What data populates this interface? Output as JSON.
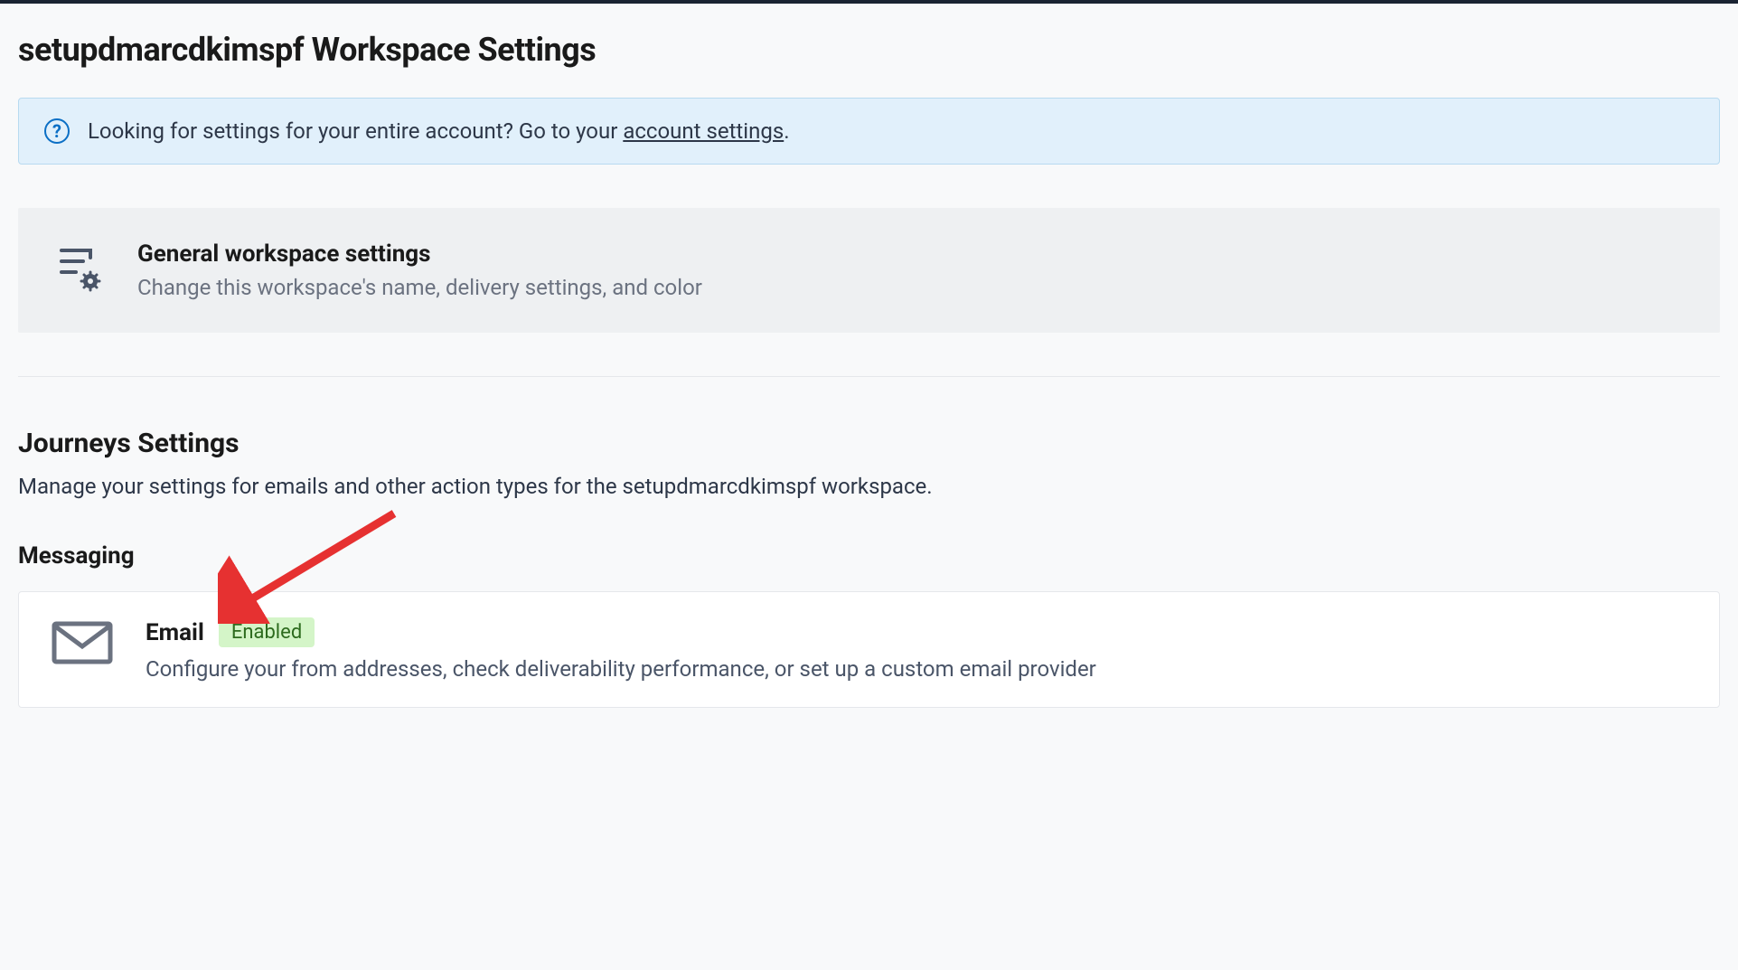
{
  "page": {
    "title": "setupdmarcdkimspf Workspace Settings"
  },
  "info_banner": {
    "text_before": "Looking for settings for your entire account? Go to your ",
    "link_text": "account settings",
    "text_after": "."
  },
  "general_settings": {
    "title": "General workspace settings",
    "description": "Change this workspace's name, delivery settings, and color"
  },
  "journeys": {
    "title": "Journeys Settings",
    "subtitle": "Manage your settings for emails and other action types for the setupdmarcdkimspf workspace."
  },
  "messaging": {
    "section_title": "Messaging",
    "email": {
      "title": "Email",
      "status": "Enabled",
      "description": "Configure your from addresses, check deliverability performance, or set up a custom email provider"
    }
  }
}
